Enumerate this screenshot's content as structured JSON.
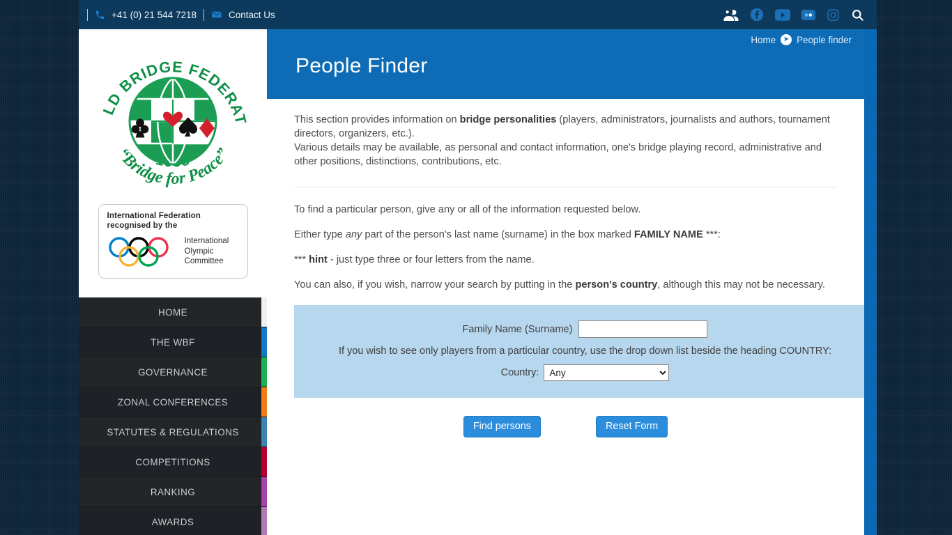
{
  "topbar": {
    "phone": "+41 (0) 21 544 7218",
    "phone_icon": "phone-icon",
    "contact_label": "Contact Us",
    "contact_icon": "envelope-icon",
    "social": [
      {
        "name": "users-icon",
        "label": "Members"
      },
      {
        "name": "facebook-icon",
        "label": "Facebook"
      },
      {
        "name": "youtube-icon",
        "label": "YouTube"
      },
      {
        "name": "flickr-icon",
        "label": "Flickr"
      },
      {
        "name": "instagram-icon",
        "label": "Instagram"
      },
      {
        "name": "search-icon",
        "label": "Search"
      }
    ],
    "background": "#0d3a5c"
  },
  "sidebar": {
    "logo": {
      "org_text": "WORLD BRIDGE FEDERATION",
      "year": "·1958·",
      "tagline": "“Bridge for Peace”",
      "green": "#14914a",
      "heart_color": "#d41f2c",
      "diamond_color": "#d41f2c",
      "spade_color": "#111111",
      "club_color": "#111111"
    },
    "ioc": {
      "line1": "International Federation",
      "line2": "recognised by the",
      "right_line1": "International",
      "right_line2": "Olympic",
      "right_line3": "Committee",
      "ring_colors": [
        "#0081c8",
        "#000000",
        "#ee334e",
        "#fcb131",
        "#00a651"
      ]
    },
    "menu": [
      {
        "label": "HOME",
        "accent": "#f0f0f0"
      },
      {
        "label": "THE WBF",
        "accent": "#1379c4"
      },
      {
        "label": "GOVERNANCE",
        "accent": "#1eb053"
      },
      {
        "label": "ZONAL CONFERENCES",
        "accent": "#f07d18"
      },
      {
        "label": "STATUTES & REGULATIONS",
        "accent": "#3b82b5"
      },
      {
        "label": "COMPETITIONS",
        "accent": "#b5002f"
      },
      {
        "label": "RANKING",
        "accent": "#a742a7"
      },
      {
        "label": "AWARDS",
        "accent": "#b07ab5"
      }
    ]
  },
  "banner": {
    "title": "People Finder",
    "background": "#0d6cb5",
    "breadcrumb": {
      "home": "Home",
      "arrow_icon": "arrow-circle-right-icon",
      "current": "People finder"
    }
  },
  "intro": {
    "p1_before": "This section provides information on ",
    "p1_bold": "bridge personalities",
    "p1_after": " (players, administrators, journalists and authors, tournament directors, organizers, etc.).",
    "p2": "Various details may be available, as personal and contact information, one's bridge playing record, administrative and other positions, distinctions, contributions, etc."
  },
  "instructions": {
    "line1": "To find a particular person, give any or all of the information requested below.",
    "line2_a": "Either type ",
    "line2_italic": "any",
    "line2_b": " part of the person's last name (surname) in the box marked ",
    "line2_bold": "FAMILY NAME",
    "line2_c": " ***:",
    "line3_a": "*** ",
    "line3_bold": "hint",
    "line3_b": " - just type three or four letters from the name.",
    "line4_a": "You can also, if you wish, narrow your search by putting in the ",
    "line4_bold": "person's country",
    "line4_b": ", although this may not be necessary."
  },
  "form": {
    "family_name_label": "Family Name (Surname)",
    "family_name_value": "",
    "family_name_placeholder": "",
    "country_hint": "If you wish to see only players from a particular country, use the drop down list beside the heading COUNTRY:",
    "country_label": "Country:",
    "country_selected": "Any",
    "country_options": [
      "Any"
    ],
    "panel_background": "#b7d7ef",
    "find_button": "Find persons",
    "reset_button": "Reset Form",
    "button_color": "#2b8ddb"
  }
}
